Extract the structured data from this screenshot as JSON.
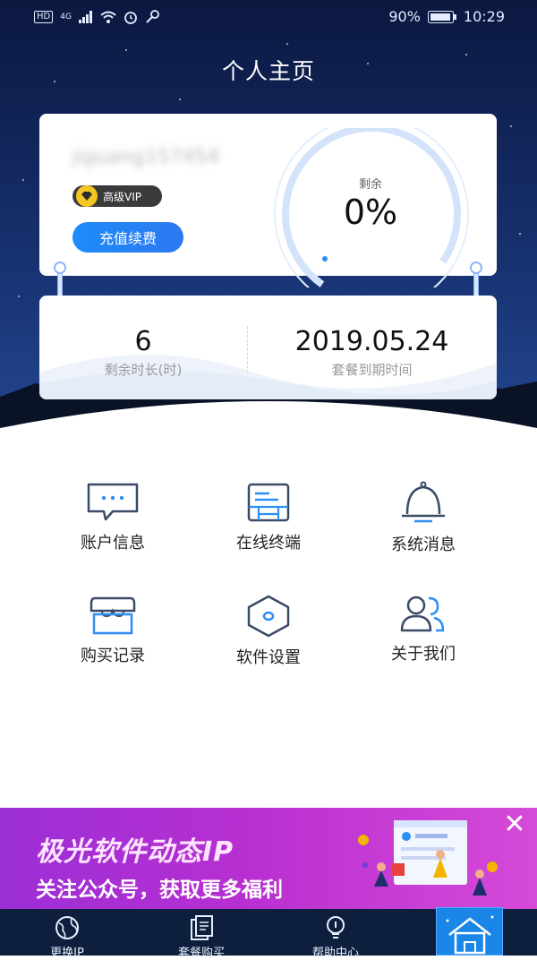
{
  "status_bar": {
    "network_badge": "HD",
    "network_type": "4G",
    "battery": "90%",
    "time": "10:29"
  },
  "header": {
    "title": "个人主页"
  },
  "profile": {
    "username": "jiguang157454",
    "vip_label": "高级VIP",
    "recharge_button": "充值续费",
    "remain_label": "剩余",
    "remain_value": "0%",
    "remain_fraction": 0
  },
  "stats": {
    "left_value": "6",
    "left_label": "剩余时长(时)",
    "right_value": "2019.05.24",
    "right_label": "套餐到期时间"
  },
  "menu": {
    "items": [
      {
        "label": "账户信息",
        "icon": "chat-bubble-icon"
      },
      {
        "label": "在线终端",
        "icon": "terminal-icon"
      },
      {
        "label": "系统消息",
        "icon": "bell-icon"
      },
      {
        "label": "购买记录",
        "icon": "shop-icon"
      },
      {
        "label": "软件设置",
        "icon": "hexagon-settings-icon"
      },
      {
        "label": "关于我们",
        "icon": "users-icon"
      }
    ]
  },
  "banner": {
    "title": "极光软件动态IP",
    "subtitle": "关注公众号，获取更多福利",
    "close_icon": "close-icon"
  },
  "bottom_nav": {
    "items": [
      {
        "label": "更换IP",
        "icon": "globe-icon"
      },
      {
        "label": "套餐购买",
        "icon": "document-icon"
      },
      {
        "label": "帮助中心",
        "icon": "lightbulb-icon"
      }
    ],
    "active_icon": "home-icon"
  },
  "colors": {
    "accent": "#1d8cf8",
    "header_dark": "#0b1840",
    "banner": "#b72fd1",
    "nav_bg": "#0d1f3c"
  }
}
